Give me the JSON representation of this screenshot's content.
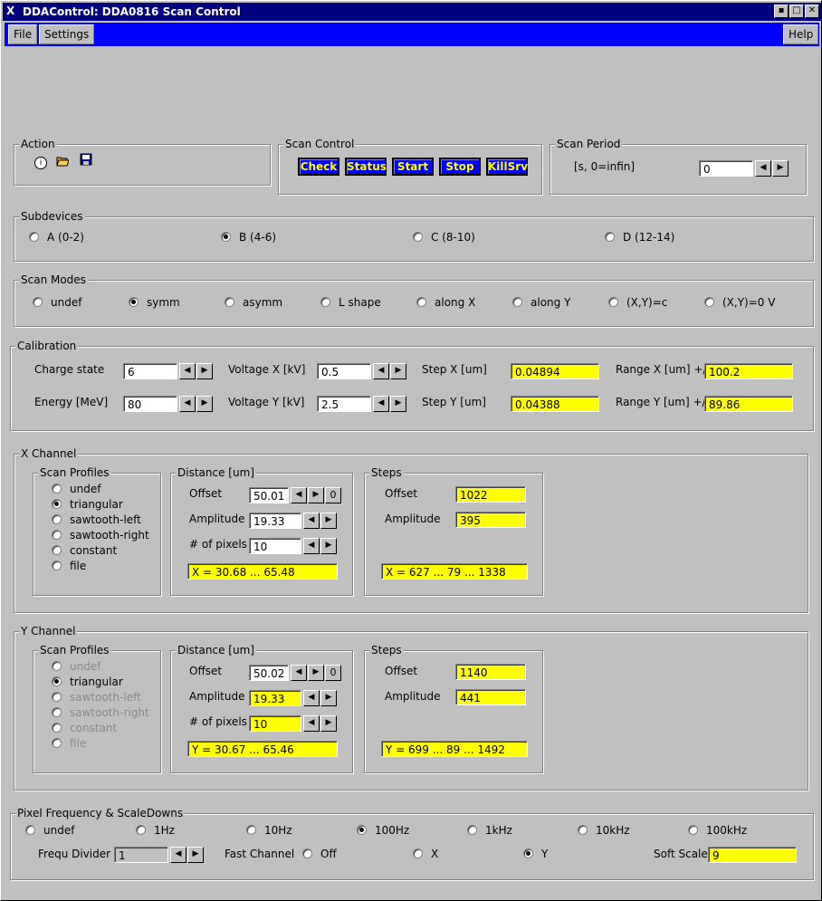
{
  "window": {
    "title": "DDAControl: DDA0816 Scan Control",
    "icon": "X",
    "min": "▪",
    "max": "□",
    "close": "✕"
  },
  "menu": {
    "file": "File",
    "settings": "Settings",
    "help": "Help"
  },
  "action": {
    "label": "Action",
    "icons": [
      "info-icon",
      "open-folder-icon",
      "save-icon"
    ]
  },
  "scan_control": {
    "label": "Scan Control",
    "buttons": [
      "Check",
      "Status",
      "Start",
      "Stop",
      "KillSrv"
    ]
  },
  "scan_period": {
    "label": "Scan Period",
    "unit": "[s, 0=infin]",
    "value": "0"
  },
  "subdevices": {
    "label": "Subdevices",
    "options": [
      "A (0-2)",
      "B (4-6)",
      "C (8-10)",
      "D (12-14)"
    ],
    "selected": 1
  },
  "scan_modes": {
    "label": "Scan Modes",
    "options": [
      "undef",
      "symm",
      "asymm",
      "L shape",
      "along X",
      "along Y",
      "(X,Y)=c",
      "(X,Y)=0 V"
    ],
    "selected": 1
  },
  "calibration": {
    "label": "Calibration",
    "charge_state": {
      "label": "Charge state",
      "value": "6"
    },
    "energy": {
      "label": "Energy [MeV]",
      "value": "80"
    },
    "voltage_x": {
      "label": "Voltage X [kV]",
      "value": "0.5"
    },
    "voltage_y": {
      "label": "Voltage Y [kV]",
      "value": "2.5"
    },
    "step_x": {
      "label": "Step X [um]",
      "value": "0.04894"
    },
    "step_y": {
      "label": "Step Y [um]",
      "value": "0.04388"
    },
    "range_x": {
      "label": "Range X [um] +/-",
      "value": "100.2"
    },
    "range_y": {
      "label": "Range Y [um] +/-",
      "value": "89.86"
    }
  },
  "x_channel": {
    "label": "X Channel",
    "profiles_label": "Scan Profiles",
    "profiles": [
      "undef",
      "triangular",
      "sawtooth-left",
      "sawtooth-right",
      "constant",
      "file"
    ],
    "selected": 1,
    "distance_label": "Distance [um]",
    "offset_label": "Offset",
    "offset": "50.01",
    "zero": "0",
    "amplitude_label": "Amplitude",
    "amplitude": "19.33",
    "pixels_label": "# of pixels",
    "pixels": "10",
    "range": "X = 30.68 ... 65.48",
    "steps_label": "Steps",
    "steps_offset_label": "Offset",
    "steps_offset": "1022",
    "steps_amp_label": "Amplitude",
    "steps_amp": "395",
    "steps_range": "X = 627 ... 79 ... 1338"
  },
  "y_channel": {
    "label": "Y Channel",
    "profiles_label": "Scan Profiles",
    "profiles": [
      "undef",
      "triangular",
      "sawtooth-left",
      "sawtooth-right",
      "constant",
      "file"
    ],
    "selected": 1,
    "distance_label": "Distance [um]",
    "offset_label": "Offset",
    "offset": "50.02",
    "zero": "0",
    "amplitude_label": "Amplitude",
    "amplitude": "19.33",
    "pixels_label": "# of pixels",
    "pixels": "10",
    "range": "Y = 30.67 ... 65.46",
    "steps_label": "Steps",
    "steps_offset_label": "Offset",
    "steps_offset": "1140",
    "steps_amp_label": "Amplitude",
    "steps_amp": "441",
    "steps_range": "Y = 699 ... 89 ... 1492"
  },
  "pixel_freq": {
    "label": "Pixel Frequency & ScaleDowns",
    "options": [
      "undef",
      "1Hz",
      "10Hz",
      "100Hz",
      "1kHz",
      "10kHz",
      "100kHz"
    ],
    "selected": 3,
    "divider_label": "Frequ Divider",
    "divider": "1",
    "fast_channel_label": "Fast Channel",
    "fast_options": [
      "Off",
      "X",
      "Y"
    ],
    "fast_selected": 2,
    "soft_scale_label": "Soft Scale",
    "soft_scale": "9"
  },
  "colors": {
    "title_bar": "#000080",
    "menu_bar": "#0000ff",
    "button_text": "#ffff00",
    "highlight_field": "#ffff00"
  }
}
